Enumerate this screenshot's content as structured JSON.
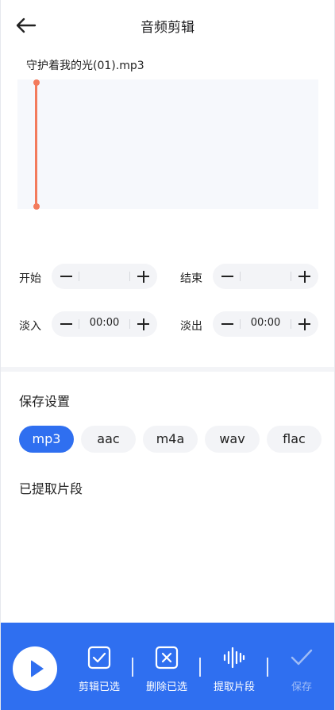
{
  "header": {
    "title": "音频剪辑"
  },
  "file": {
    "name": "守护着我的光(01).mp3"
  },
  "fields": {
    "start": {
      "label": "开始",
      "value": ""
    },
    "end": {
      "label": "结束",
      "value": ""
    },
    "fade_in": {
      "label": "淡入",
      "value": "00:00"
    },
    "fade_out": {
      "label": "淡出",
      "value": "00:00"
    }
  },
  "save_settings": {
    "title": "保存设置",
    "formats": [
      "mp3",
      "aac",
      "m4a",
      "wav",
      "flac"
    ],
    "selected": "mp3"
  },
  "extracted": {
    "title": "已提取片段"
  },
  "bottom_bar": {
    "actions": [
      {
        "label": "剪辑已选",
        "icon": "check-square-icon"
      },
      {
        "label": "删除已选",
        "icon": "x-square-icon"
      },
      {
        "label": "提取片段",
        "icon": "waveform-icon"
      },
      {
        "label": "保存",
        "icon": "checkmark-icon",
        "disabled": true
      }
    ]
  },
  "colors": {
    "accent": "#2f6ff0",
    "cursor": "#f37b5c",
    "field_bg": "#f3f4f7"
  }
}
